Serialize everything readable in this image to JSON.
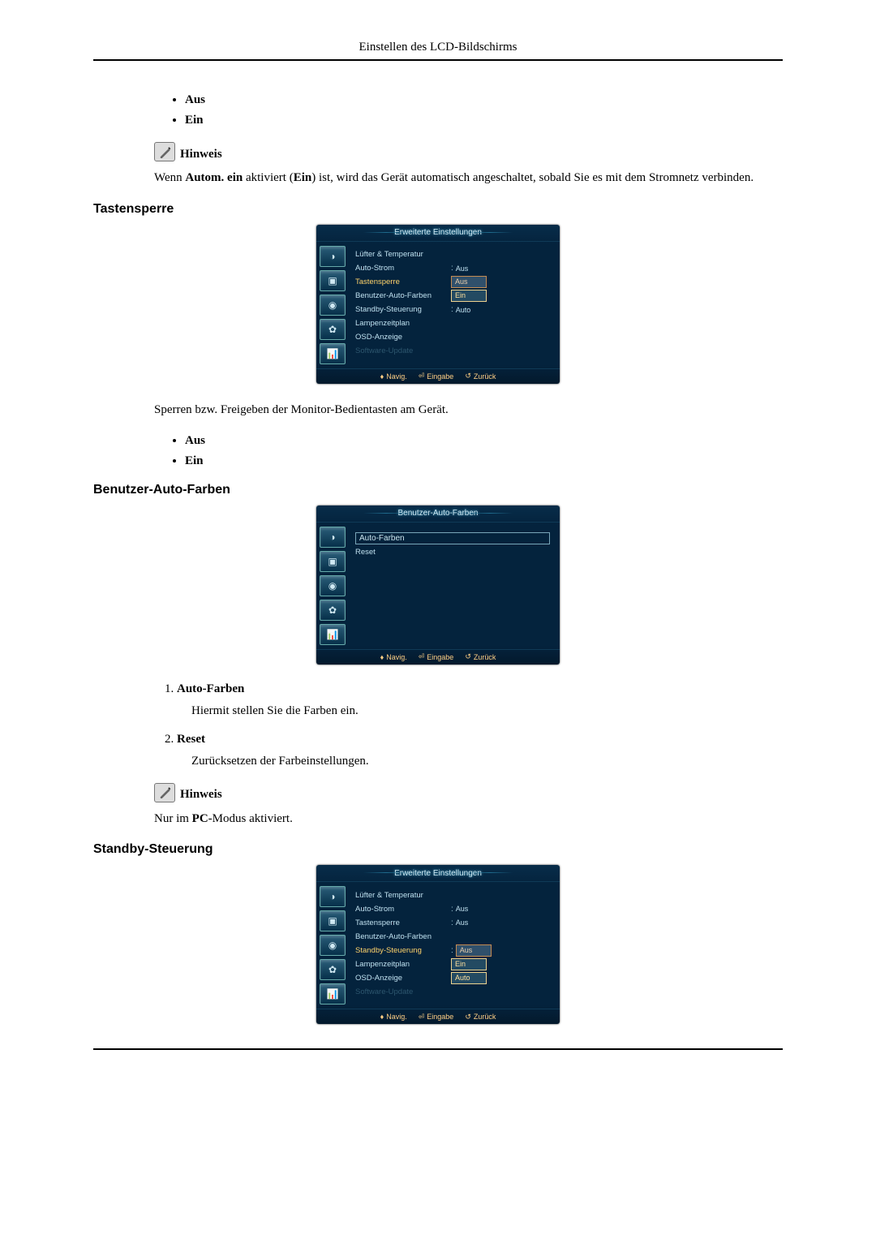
{
  "header": {
    "title": "Einstellen des LCD-Bildschirms"
  },
  "sec_autom": {
    "bullets": {
      "aus": "Aus",
      "ein": "Ein"
    },
    "note_label": "Hinweis",
    "note_text": {
      "pre": "Wenn ",
      "b1": "Autom. ein",
      "mid": " aktiviert (",
      "b2": "Ein",
      "post": ") ist, wird das Gerät automatisch angeschaltet, sobald Sie es mit dem Stromnetz verbinden."
    }
  },
  "sec_tastensperre": {
    "heading": "Tastensperre",
    "osd": {
      "title": "Erweiterte Einstellungen",
      "rows": [
        {
          "label": "Lüfter & Temperatur",
          "value": ""
        },
        {
          "label": "Auto-Strom",
          "value": "Aus",
          "colon": ":"
        },
        {
          "label": "Tastensperre",
          "value": "Aus",
          "sel": true,
          "box": "hl2"
        },
        {
          "label": "Benutzer-Auto-Farben",
          "value": "Ein",
          "box": "hl"
        },
        {
          "label": "Standby-Steuerung",
          "value": "Auto",
          "colon": ":"
        },
        {
          "label": "Lampenzeitplan",
          "value": ""
        },
        {
          "label": "OSD-Anzeige",
          "value": ""
        },
        {
          "label": "Software-Update",
          "value": "",
          "dim": true
        }
      ],
      "footer": {
        "navig": "Navig.",
        "eingabe": "Eingabe",
        "zuruck": "Zurück"
      }
    },
    "desc": "Sperren bzw. Freigeben der Monitor-Bedientasten am Gerät.",
    "bullets": {
      "aus": "Aus",
      "ein": "Ein"
    }
  },
  "sec_benutzerauto": {
    "heading": "Benutzer-Auto-Farben",
    "osd": {
      "title": "Benutzer-Auto-Farben",
      "rows": [
        {
          "label": "Auto-Farben",
          "value": "",
          "plainbox": true
        },
        {
          "label": "Reset",
          "value": ""
        }
      ],
      "footer": {
        "navig": "Navig.",
        "eingabe": "Eingabe",
        "zuruck": "Zurück"
      }
    },
    "numlist": {
      "item1": {
        "title": "Auto-Farben",
        "desc": "Hiermit stellen Sie die Farben ein."
      },
      "item2": {
        "title": "Reset",
        "desc": "Zurücksetzen der Farbeinstellungen."
      }
    },
    "note_label": "Hinweis",
    "note_text": {
      "pre": "Nur im ",
      "b1": "PC",
      "post": "-Modus aktiviert."
    }
  },
  "sec_standby": {
    "heading": "Standby-Steuerung",
    "osd": {
      "title": "Erweiterte Einstellungen",
      "rows": [
        {
          "label": "Lüfter & Temperatur",
          "value": ""
        },
        {
          "label": "Auto-Strom",
          "value": "Aus",
          "colon": ":"
        },
        {
          "label": "Tastensperre",
          "value": "Aus",
          "colon": ":"
        },
        {
          "label": "Benutzer-Auto-Farben",
          "value": ""
        },
        {
          "label": "Standby-Steuerung",
          "value": "Aus",
          "sel": true,
          "box": "hl2",
          "colon": ":"
        },
        {
          "label": "Lampenzeitplan",
          "value": "Ein",
          "box": "hl"
        },
        {
          "label": "OSD-Anzeige",
          "value": "Auto",
          "box": "hl"
        },
        {
          "label": "Software-Update",
          "value": "",
          "dim": true
        }
      ],
      "footer": {
        "navig": "Navig.",
        "eingabe": "Eingabe",
        "zuruck": "Zurück"
      }
    }
  },
  "icons": {
    "sidebar": [
      "◑",
      "▣",
      "◉",
      "✿",
      "📊"
    ]
  }
}
